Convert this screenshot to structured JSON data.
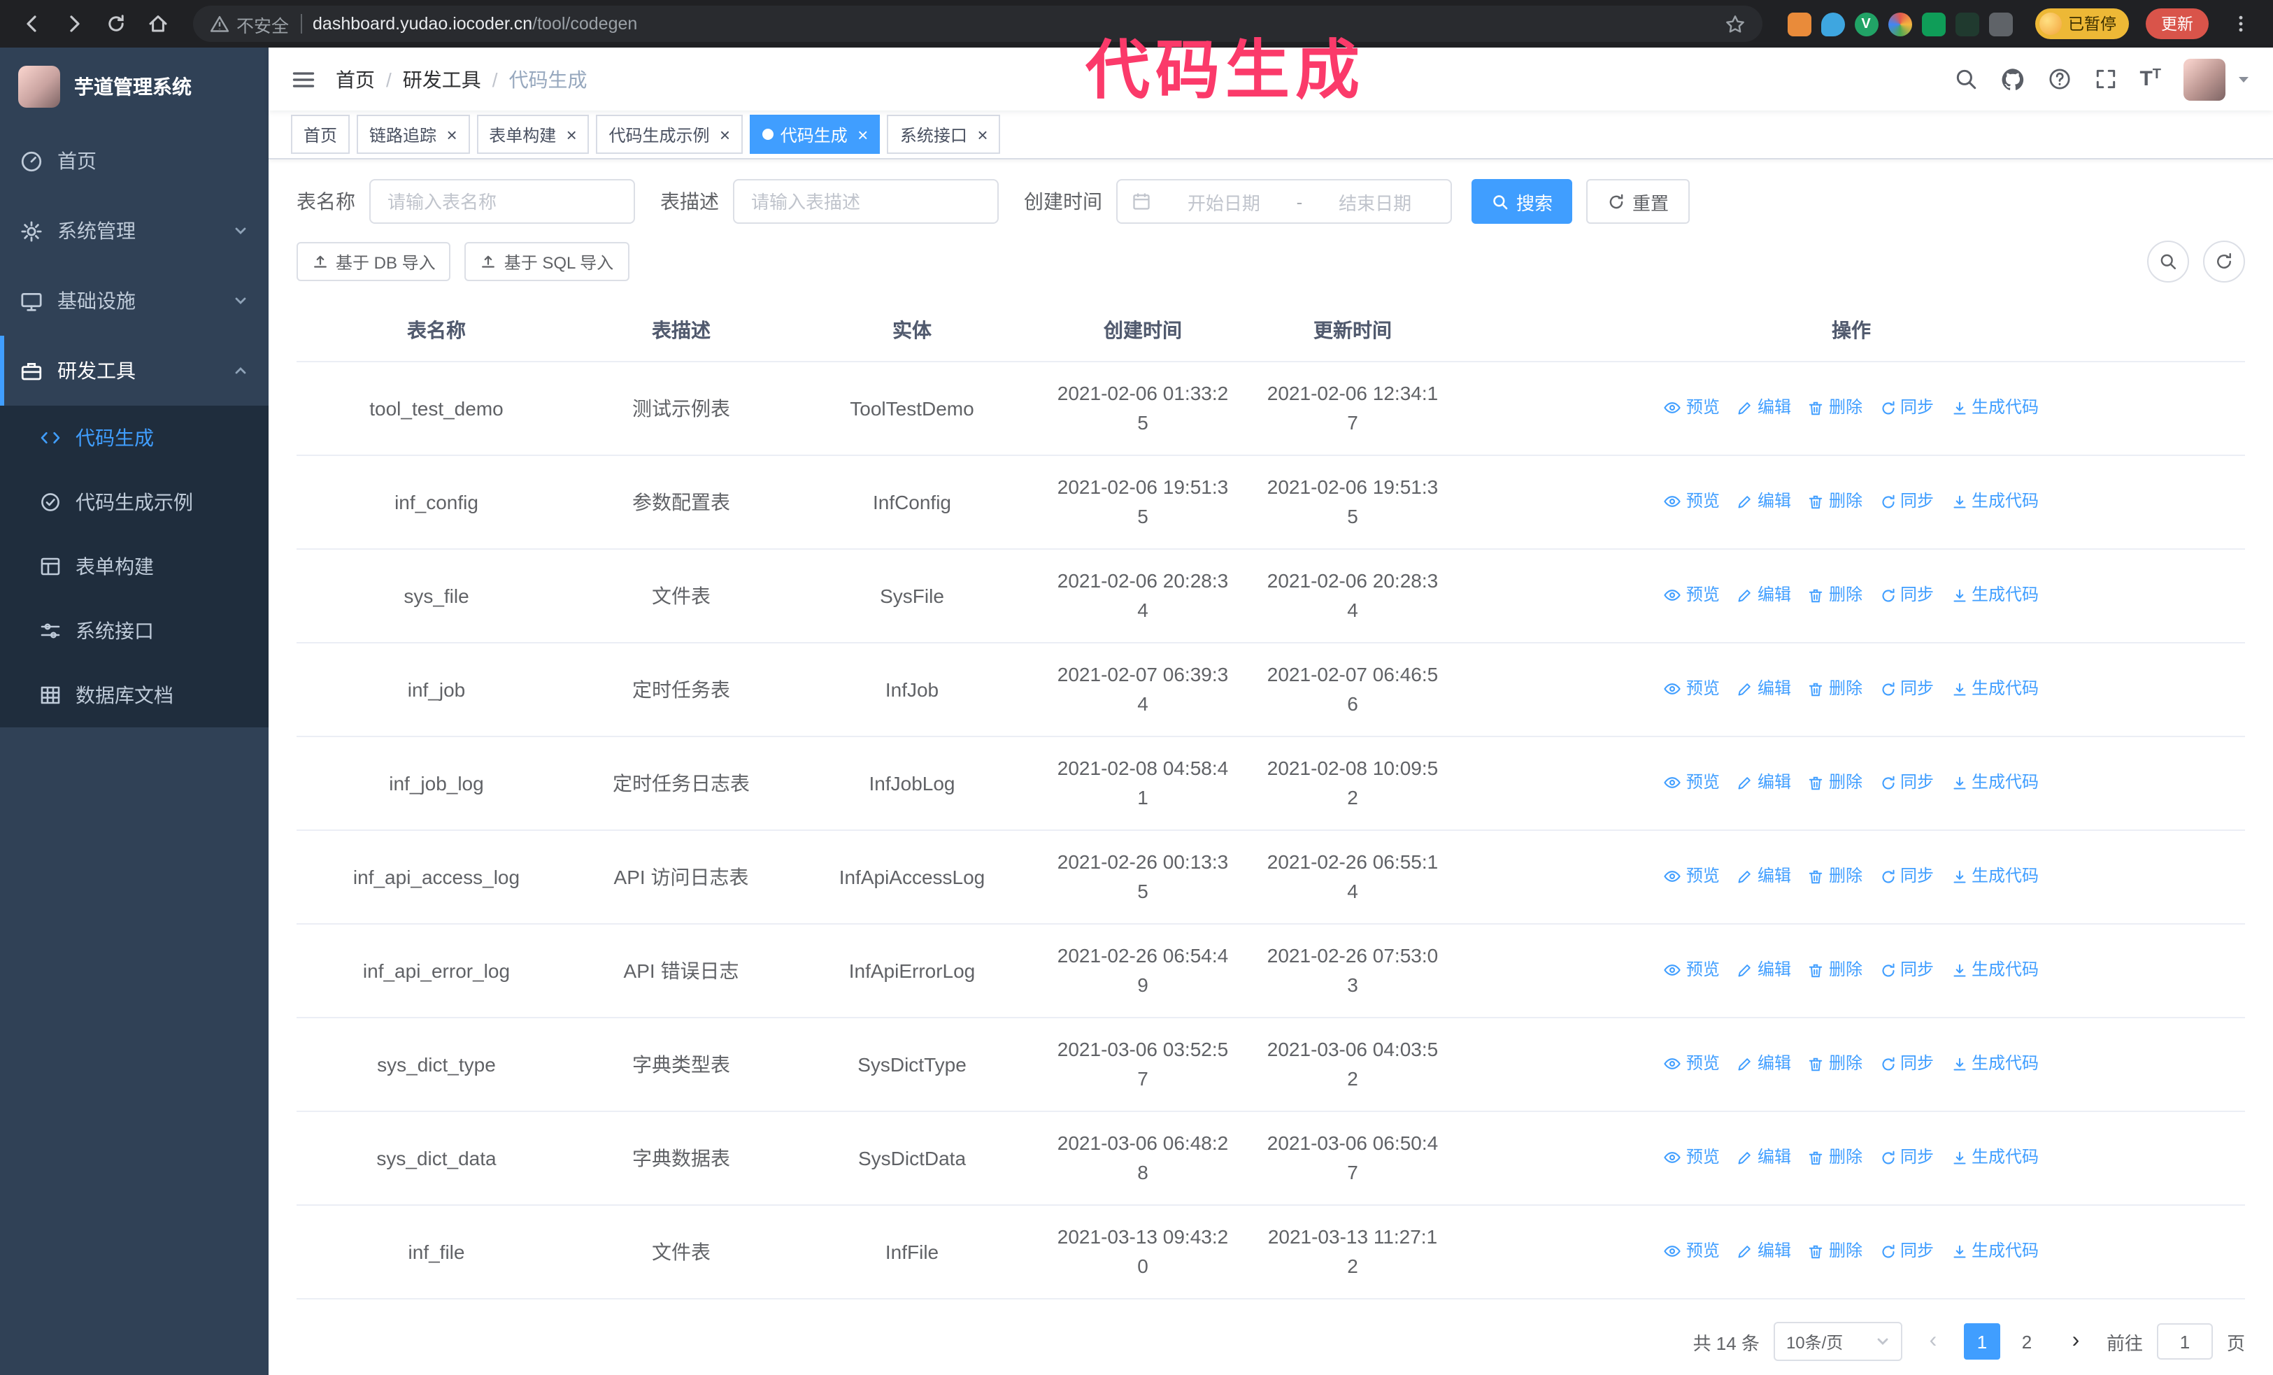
{
  "annotation": {
    "text": "代码生成",
    "color": "#fb3a6a"
  },
  "theme": {
    "accent": "#409eff",
    "sidebar_bg": "#304156",
    "submenu_bg": "#1f2d3d",
    "annotation": "#fb3a6a",
    "update_button": "#d9544a",
    "paused_chip": "#edb836"
  },
  "browser": {
    "security_label": "不安全",
    "url_host": "dashboard.yudao.iocoder.cn",
    "url_path": "/tool/codegen",
    "paused_badge": "已暂停",
    "update_button": "更新"
  },
  "sidebar": {
    "logo_title": "芋道管理系统",
    "items": [
      {
        "label": "首页"
      },
      {
        "label": "系统管理"
      },
      {
        "label": "基础设施"
      },
      {
        "label": "研发工具",
        "expanded": true,
        "children": [
          {
            "label": "代码生成",
            "active": true
          },
          {
            "label": "代码生成示例"
          },
          {
            "label": "表单构建"
          },
          {
            "label": "系统接口"
          },
          {
            "label": "数据库文档"
          }
        ]
      }
    ]
  },
  "navbar": {
    "breadcrumb": [
      "首页",
      "研发工具",
      "代码生成"
    ]
  },
  "tabs": [
    {
      "label": "首页",
      "closable": false,
      "active": false
    },
    {
      "label": "链路追踪",
      "closable": true,
      "active": false
    },
    {
      "label": "表单构建",
      "closable": true,
      "active": false
    },
    {
      "label": "代码生成示例",
      "closable": true,
      "active": false
    },
    {
      "label": "代码生成",
      "closable": true,
      "active": true
    },
    {
      "label": "系统接口",
      "closable": true,
      "active": false
    }
  ],
  "search": {
    "name_label": "表名称",
    "name_placeholder": "请输入表名称",
    "desc_label": "表描述",
    "desc_placeholder": "请输入表描述",
    "time_label": "创建时间",
    "start_placeholder": "开始日期",
    "separator": "-",
    "end_placeholder": "结束日期",
    "search_button": "搜索",
    "reset_button": "重置"
  },
  "toolbar": {
    "import_db": "基于 DB 导入",
    "import_sql": "基于 SQL 导入"
  },
  "table": {
    "columns": [
      "表名称",
      "表描述",
      "实体",
      "创建时间",
      "更新时间",
      "操作"
    ],
    "actions": [
      "预览",
      "编辑",
      "删除",
      "同步",
      "生成代码"
    ],
    "rows": [
      {
        "name": "tool_test_demo",
        "desc": "测试示例表",
        "entity": "ToolTestDemo",
        "created": "2021-02-06 01:33:25",
        "updated": "2021-02-06 12:34:17"
      },
      {
        "name": "inf_config",
        "desc": "参数配置表",
        "entity": "InfConfig",
        "created": "2021-02-06 19:51:35",
        "updated": "2021-02-06 19:51:35"
      },
      {
        "name": "sys_file",
        "desc": "文件表",
        "entity": "SysFile",
        "created": "2021-02-06 20:28:34",
        "updated": "2021-02-06 20:28:34"
      },
      {
        "name": "inf_job",
        "desc": "定时任务表",
        "entity": "InfJob",
        "created": "2021-02-07 06:39:34",
        "updated": "2021-02-07 06:46:56"
      },
      {
        "name": "inf_job_log",
        "desc": "定时任务日志表",
        "entity": "InfJobLog",
        "created": "2021-02-08 04:58:41",
        "updated": "2021-02-08 10:09:52"
      },
      {
        "name": "inf_api_access_log",
        "desc": "API 访问日志表",
        "entity": "InfApiAccessLog",
        "created": "2021-02-26 00:13:35",
        "updated": "2021-02-26 06:55:14"
      },
      {
        "name": "inf_api_error_log",
        "desc": "API 错误日志",
        "entity": "InfApiErrorLog",
        "created": "2021-02-26 06:54:49",
        "updated": "2021-02-26 07:53:03"
      },
      {
        "name": "sys_dict_type",
        "desc": "字典类型表",
        "entity": "SysDictType",
        "created": "2021-03-06 03:52:57",
        "updated": "2021-03-06 04:03:52"
      },
      {
        "name": "sys_dict_data",
        "desc": "字典数据表",
        "entity": "SysDictData",
        "created": "2021-03-06 06:48:28",
        "updated": "2021-03-06 06:50:47"
      },
      {
        "name": "inf_file",
        "desc": "文件表",
        "entity": "InfFile",
        "created": "2021-03-13 09:43:20",
        "updated": "2021-03-13 11:27:12"
      }
    ]
  },
  "pagination": {
    "total": "共 14 条",
    "page_size": "10条/页",
    "pages": [
      "1",
      "2"
    ],
    "active_page": "1",
    "goto_label": "前往",
    "goto_value": "1",
    "goto_suffix": "页"
  }
}
